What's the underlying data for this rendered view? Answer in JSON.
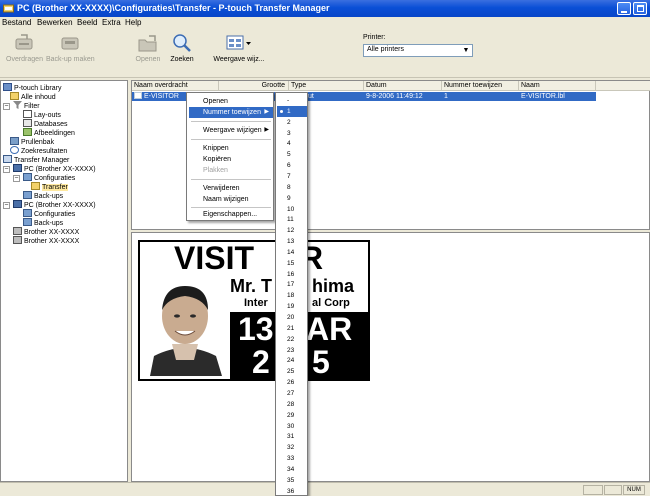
{
  "window": {
    "title": "PC (Brother XX-XXXX)\\Configuraties\\Transfer - P-touch Transfer Manager",
    "colors": {
      "titlebar": "#0a4fd6",
      "selection": "#316ac5"
    }
  },
  "menubar": {
    "items": [
      "Bestand",
      "Bewerken",
      "Beeld",
      "Extra",
      "Help"
    ]
  },
  "toolbar": {
    "buttons": [
      {
        "label": "Overdragen",
        "icon": "transfer-icon",
        "enabled": false
      },
      {
        "label": "Back-up maken",
        "icon": "backup-icon",
        "enabled": false
      },
      {
        "label": "Openen",
        "icon": "open-icon",
        "enabled": false
      },
      {
        "label": "Zoeken",
        "icon": "search-icon",
        "enabled": true
      },
      {
        "label": "Weergave wijz...",
        "icon": "view-icon",
        "enabled": true
      }
    ],
    "printer_label": "Printer:",
    "printer_value": "Alle printers"
  },
  "tree": {
    "items": [
      {
        "label": "P-touch Library",
        "icon": "library-icon"
      },
      {
        "label": "Alle inhoud",
        "icon": "folder-icon"
      },
      {
        "label": "Filter",
        "icon": "filter-icon"
      },
      {
        "label": "Lay-outs",
        "icon": "layout-icon"
      },
      {
        "label": "Databases",
        "icon": "database-icon"
      },
      {
        "label": "Afbeeldingen",
        "icon": "image-icon"
      },
      {
        "label": "Prullenbak",
        "icon": "trash-icon"
      },
      {
        "label": "Zoekresultaten",
        "icon": "search-icon"
      },
      {
        "label": "Transfer Manager",
        "icon": "transfer-icon"
      },
      {
        "label": "PC (Brother XX-XXXX)",
        "icon": "pc-icon"
      },
      {
        "label": "Configuraties",
        "icon": "config-icon"
      },
      {
        "label": "Transfer",
        "icon": "folder-icon"
      },
      {
        "label": "Back-ups",
        "icon": "backup-icon"
      },
      {
        "label": "PC (Brother XX-XXXX)",
        "icon": "pc-icon"
      },
      {
        "label": "Configuraties",
        "icon": "config-icon"
      },
      {
        "label": "Back-ups",
        "icon": "backup-icon"
      },
      {
        "label": "Brother XX-XXXX",
        "icon": "printer-icon"
      },
      {
        "label": "Brother XX-XXXX",
        "icon": "printer-icon"
      }
    ]
  },
  "list": {
    "columns": [
      "Naam overdracht",
      "Grootte",
      "Type",
      "Datum",
      "Nummer toewijzen",
      "Naam"
    ],
    "rows": [
      {
        "name": "E-VISITOR",
        "size": "",
        "type": "ut",
        "date": "9-8-2006 11:49:12",
        "number": "1",
        "file": "E-VISITOR.lbl"
      }
    ]
  },
  "context_menu": {
    "items": [
      {
        "label": "Openen",
        "state": "normal"
      },
      {
        "label": "Nummer toewijzen",
        "state": "highlighted",
        "submenu": true
      },
      {
        "label": "Weergave wijzigen",
        "state": "normal",
        "submenu": true
      },
      {
        "label": "Knippen",
        "state": "normal"
      },
      {
        "label": "Kopiëren",
        "state": "normal"
      },
      {
        "label": "Plakken",
        "state": "disabled"
      },
      {
        "label": "Verwijderen",
        "state": "normal"
      },
      {
        "label": "Naam wijzigen",
        "state": "normal"
      },
      {
        "label": "Eigenschappen...",
        "state": "normal"
      }
    ]
  },
  "number_submenu": {
    "items": [
      "-",
      "1",
      "2",
      "3",
      "4",
      "5",
      "6",
      "7",
      "8",
      "9",
      "10",
      "11",
      "12",
      "13",
      "14",
      "15",
      "16",
      "17",
      "18",
      "19",
      "20",
      "21",
      "22",
      "23",
      "24",
      "25",
      "26",
      "27",
      "28",
      "29",
      "30",
      "31",
      "32",
      "33",
      "34",
      "35",
      "36"
    ],
    "selected": "1"
  },
  "preview_label": {
    "heading_left": "VISIT",
    "heading_right": "R",
    "name_left": "Mr. T",
    "name_right": "hima",
    "company_left": "Inter",
    "company_right": "al Corp",
    "date_left": "13",
    "date_right": "AR",
    "year_left": "2",
    "year_right": "5"
  },
  "statusbar": {
    "mode": "NUM"
  }
}
